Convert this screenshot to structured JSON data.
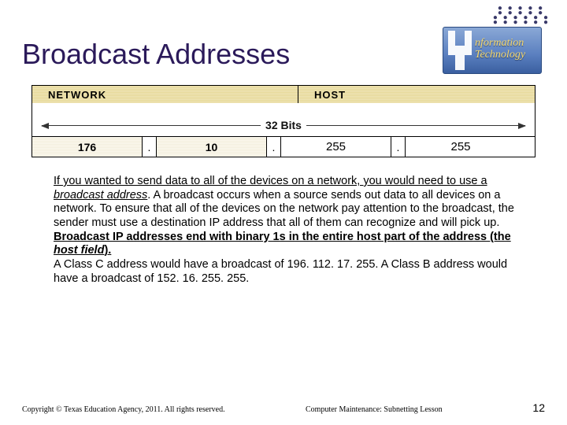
{
  "title": "Broadcast Addresses",
  "logo": {
    "line1": "nformation",
    "line2": "Technology"
  },
  "diagram": {
    "header_network": "NETWORK",
    "header_host": "HOST",
    "bits_label": "32 Bits",
    "octet1": "176",
    "octet2": "10",
    "octet3": "255",
    "octet4": "255",
    "dot": "."
  },
  "paragraph": {
    "s1a": "If you wanted to send data to all of the devices on a network, you would need to use a ",
    "s1b": "broadcast address",
    "s1c": ". A broadcast occurs when a source sends out data to all devices on a network. To ensure that all of the devices on the network pay attention to the broadcast, the sender must use a destination IP address that all of them can recognize and will pick up. ",
    "s2a": "Broadcast IP addresses end with binary 1s in the entire host part of the address (the ",
    "s2b": "host field",
    "s2c": ").",
    "s3": "A Class C address would have a broadcast of 196. 112. 17. 255. A Class B address would have a broadcast of 152. 16. 255. 255."
  },
  "footer": {
    "copyright": "Copyright © Texas Education Agency, 2011. All rights reserved.",
    "lesson": "Computer Maintenance: Subnetting Lesson",
    "page": "12"
  }
}
